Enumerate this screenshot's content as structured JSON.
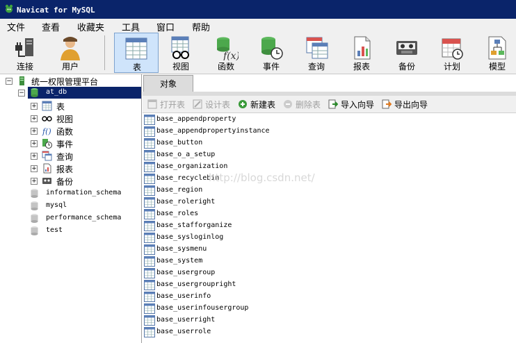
{
  "window": {
    "title": "Navicat for MySQL"
  },
  "menu": [
    "文件",
    "查看",
    "收藏夹",
    "工具",
    "窗口",
    "帮助"
  ],
  "toolbar": [
    {
      "label": "连接",
      "icon": "connection-icon"
    },
    {
      "label": "用户",
      "icon": "user-icon"
    },
    {
      "label": "表",
      "icon": "table-icon",
      "active": true
    },
    {
      "label": "视图",
      "icon": "view-icon"
    },
    {
      "label": "函数",
      "icon": "function-icon"
    },
    {
      "label": "事件",
      "icon": "event-icon"
    },
    {
      "label": "查询",
      "icon": "query-icon"
    },
    {
      "label": "报表",
      "icon": "report-icon"
    },
    {
      "label": "备份",
      "icon": "backup-icon"
    },
    {
      "label": "计划",
      "icon": "schedule-icon"
    },
    {
      "label": "模型",
      "icon": "model-icon"
    }
  ],
  "tree": {
    "connection": "统一权限管理平台",
    "database": "at_db",
    "children": [
      "表",
      "视图",
      "函数",
      "事件",
      "查询",
      "报表",
      "备份"
    ],
    "other_databases": [
      "information_schema",
      "mysql",
      "performance_schema",
      "test"
    ]
  },
  "objects_tab": "对象",
  "object_toolbar": [
    {
      "label": "打开表",
      "enabled": false
    },
    {
      "label": "设计表",
      "enabled": false
    },
    {
      "label": "新建表",
      "enabled": true
    },
    {
      "label": "删除表",
      "enabled": false
    },
    {
      "label": "导入向导",
      "enabled": true
    },
    {
      "label": "导出向导",
      "enabled": true
    }
  ],
  "tables": [
    "base_appendproperty",
    "base_appendpropertyinstance",
    "base_button",
    "base_o_a_setup",
    "base_organization",
    "base_recyclebin",
    "base_region",
    "base_roleright",
    "base_roles",
    "base_stafforganize",
    "base_sysloginlog",
    "base_sysmenu",
    "base_system",
    "base_usergroup",
    "base_usergroupright",
    "base_userinfo",
    "base_userinfousergroup",
    "base_userright",
    "base_userrole"
  ],
  "watermark": "http://blog.csdn.net/",
  "colors": {
    "titlebar": "#0a246a",
    "selection": "#0a246a",
    "active_tool": "#cfe4fb"
  }
}
